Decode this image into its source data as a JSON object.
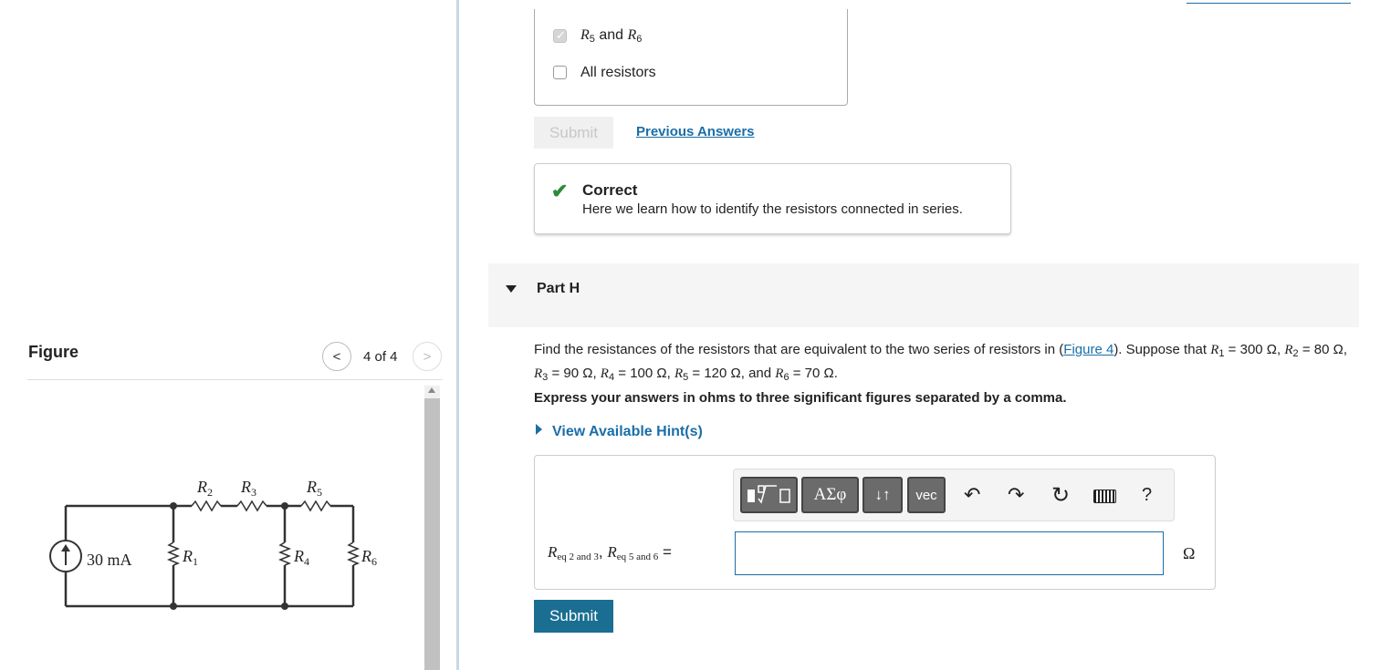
{
  "figure": {
    "title": "Figure",
    "counter": "4 of 4",
    "prev_icon": "chevron-left-icon",
    "next_icon": "chevron-right-icon",
    "circuit": {
      "source_label": "30 mA",
      "r1": "R",
      "r1_sub": "1",
      "r2": "R",
      "r2_sub": "2",
      "r3": "R",
      "r3_sub": "3",
      "r4": "R",
      "r4_sub": "4",
      "r5": "R",
      "r5_sub": "5",
      "r6": "R",
      "r6_sub": "6"
    }
  },
  "options": [
    {
      "r_a": "R",
      "a_sub": "5",
      "and": "and",
      "r_b": "R",
      "b_sub": "6",
      "checked": true
    },
    {
      "label": "All resistors",
      "checked": false
    }
  ],
  "previous_part": {
    "submit_label": "Submit",
    "previous_answers": "Previous Answers",
    "feedback_title": "Correct",
    "feedback_text": "Here we learn how to identify the resistors connected in series."
  },
  "part": {
    "label": "Part H",
    "question_parts": {
      "lead": "Find the resistances of the resistors that are equivalent to the two series of resistors in (",
      "link": "Figure 4",
      "after_link": "). Suppose that ",
      "r1": "R",
      "r1_sub": "1",
      "r1_val": " = 300 Ω,",
      "r2": "R",
      "r2_sub": "2",
      "r2_val": " = 80 Ω, ",
      "r3": "R",
      "r3_sub": "3",
      "r3_val": " = 90 Ω, ",
      "r4": "R",
      "r4_sub": "4",
      "r4_val": " = 100 Ω, ",
      "r5": "R",
      "r5_sub": "5",
      "r5_val": " = 120 Ω, and ",
      "r6": "R",
      "r6_sub": "6",
      "r6_val": " = 70 Ω."
    },
    "instruction": "Express your answers in ohms to three significant figures separated by a comma.",
    "hint_link": "View Available Hint(s)",
    "toolbar": {
      "greek": "ΑΣφ",
      "arrows": "↓↑",
      "vec": "vec",
      "help": "?"
    },
    "answer_label": {
      "r": "R",
      "sub1": "eq 2 and 3",
      "comma": ", ",
      "r2": "R",
      "sub2": "eq 5 and 6",
      "eq": " ="
    },
    "answer_value": "",
    "unit": "Ω",
    "submit_label": "Submit"
  },
  "colors": {
    "link": "#1a6ea8",
    "submit": "#1a6e92",
    "correct": "#2e8b3a"
  }
}
